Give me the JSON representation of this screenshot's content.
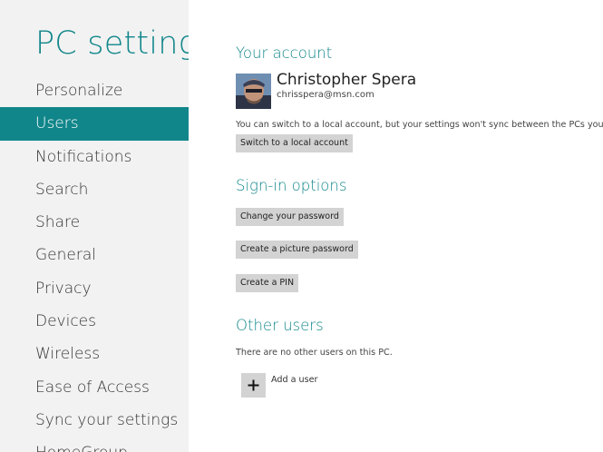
{
  "app_title": "PC settings",
  "nav": {
    "items": [
      {
        "label": "Personalize"
      },
      {
        "label": "Users",
        "selected": true
      },
      {
        "label": "Notifications"
      },
      {
        "label": "Search"
      },
      {
        "label": "Share"
      },
      {
        "label": "General"
      },
      {
        "label": "Privacy"
      },
      {
        "label": "Devices"
      },
      {
        "label": "Wireless"
      },
      {
        "label": "Ease of Access"
      },
      {
        "label": "Sync your settings"
      },
      {
        "label": "HomeGroup"
      }
    ]
  },
  "account": {
    "heading": "Your account",
    "name": "Christopher Spera",
    "email": "chrisspera@msn.com",
    "note": "You can switch to a local account, but your settings won't sync between the PCs you use.",
    "switch_button": "Switch to a local account"
  },
  "signin": {
    "heading": "Sign-in options",
    "change_password": "Change your password",
    "picture_password": "Create a picture password",
    "pin": "Create a PIN"
  },
  "other_users": {
    "heading": "Other users",
    "note": "There are no other users on this PC.",
    "add_label": "Add a user"
  },
  "colors": {
    "accent": "#11868a",
    "sidebar_bg": "#f2f2f2",
    "button_bg": "#d3d3d3"
  }
}
